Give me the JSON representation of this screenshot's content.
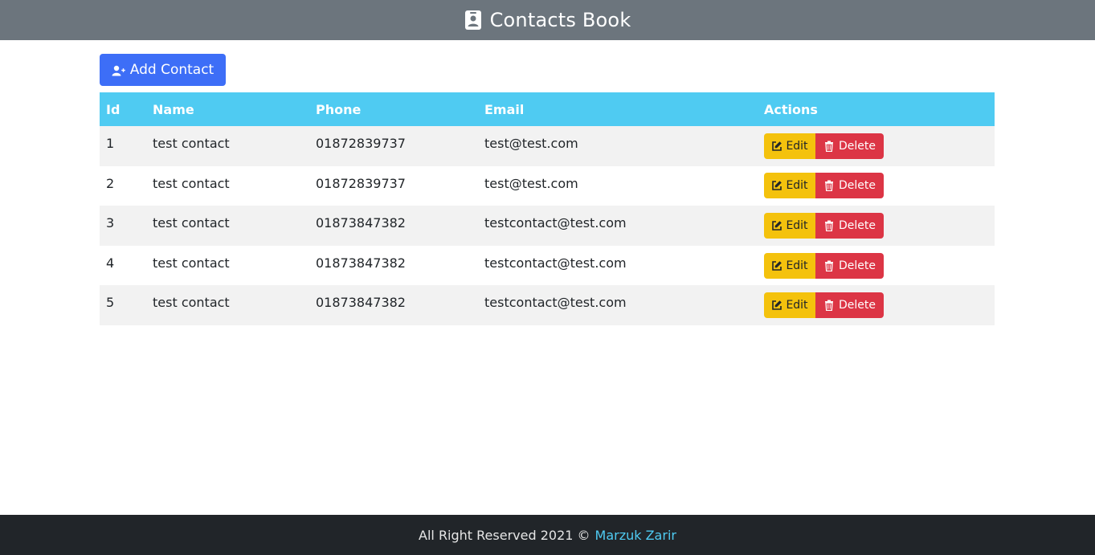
{
  "header": {
    "title": "Contacts Book",
    "icon": "contact-card-icon"
  },
  "toolbar": {
    "add_label": "Add Contact",
    "add_icon": "user-plus-icon",
    "add_color": "#3d6ef7"
  },
  "table": {
    "header_color": "#4fcbf2",
    "columns": [
      "Id",
      "Name",
      "Phone",
      "Email",
      "Actions"
    ],
    "rows": [
      {
        "id": "1",
        "name": "test contact",
        "phone": "01872839737",
        "email": "test@test.com"
      },
      {
        "id": "2",
        "name": "test contact",
        "phone": "01872839737",
        "email": "test@test.com"
      },
      {
        "id": "3",
        "name": "test contact",
        "phone": "01873847382",
        "email": "testcontact@test.com"
      },
      {
        "id": "4",
        "name": "test contact",
        "phone": "01873847382",
        "email": "testcontact@test.com"
      },
      {
        "id": "5",
        "name": "test contact",
        "phone": "01873847382",
        "email": "testcontact@test.com"
      }
    ],
    "actions": {
      "edit_label": "Edit",
      "edit_icon": "edit-icon",
      "edit_color": "#f4c20d",
      "delete_label": "Delete",
      "delete_icon": "trash-icon",
      "delete_color": "#dc3545"
    }
  },
  "footer": {
    "text": "All Right Reserved 2021 ©",
    "author_link": "Marzuk Zarir",
    "background": "#212529",
    "link_color": "#4fcbf2"
  }
}
